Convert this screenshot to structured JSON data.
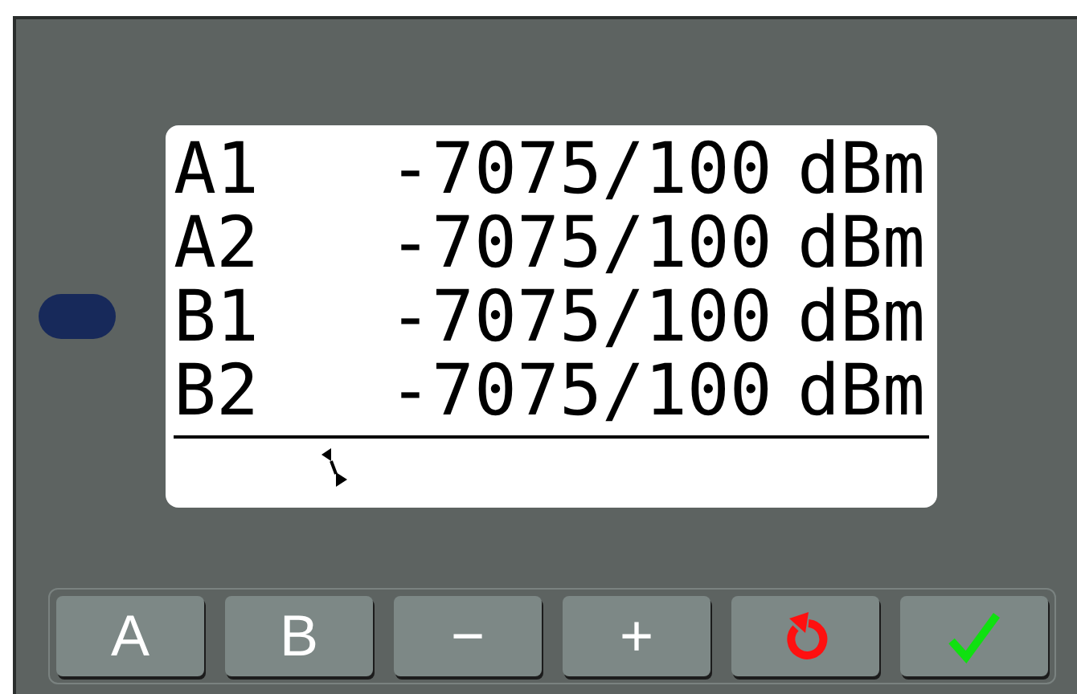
{
  "display": {
    "rows": [
      {
        "channel": "A1",
        "value": "-7075/100",
        "unit": "dBm"
      },
      {
        "channel": "A2",
        "value": "-7075/100",
        "unit": "dBm"
      },
      {
        "channel": "B1",
        "value": "-7075/100",
        "unit": "dBm"
      },
      {
        "channel": "B2",
        "value": "-7075/100",
        "unit": "dBm"
      }
    ]
  },
  "buttons": [
    {
      "kind": "text",
      "label": "A"
    },
    {
      "kind": "text",
      "label": "B"
    },
    {
      "kind": "text",
      "label": "−"
    },
    {
      "kind": "text",
      "label": "+"
    },
    {
      "kind": "reset"
    },
    {
      "kind": "confirm"
    }
  ]
}
